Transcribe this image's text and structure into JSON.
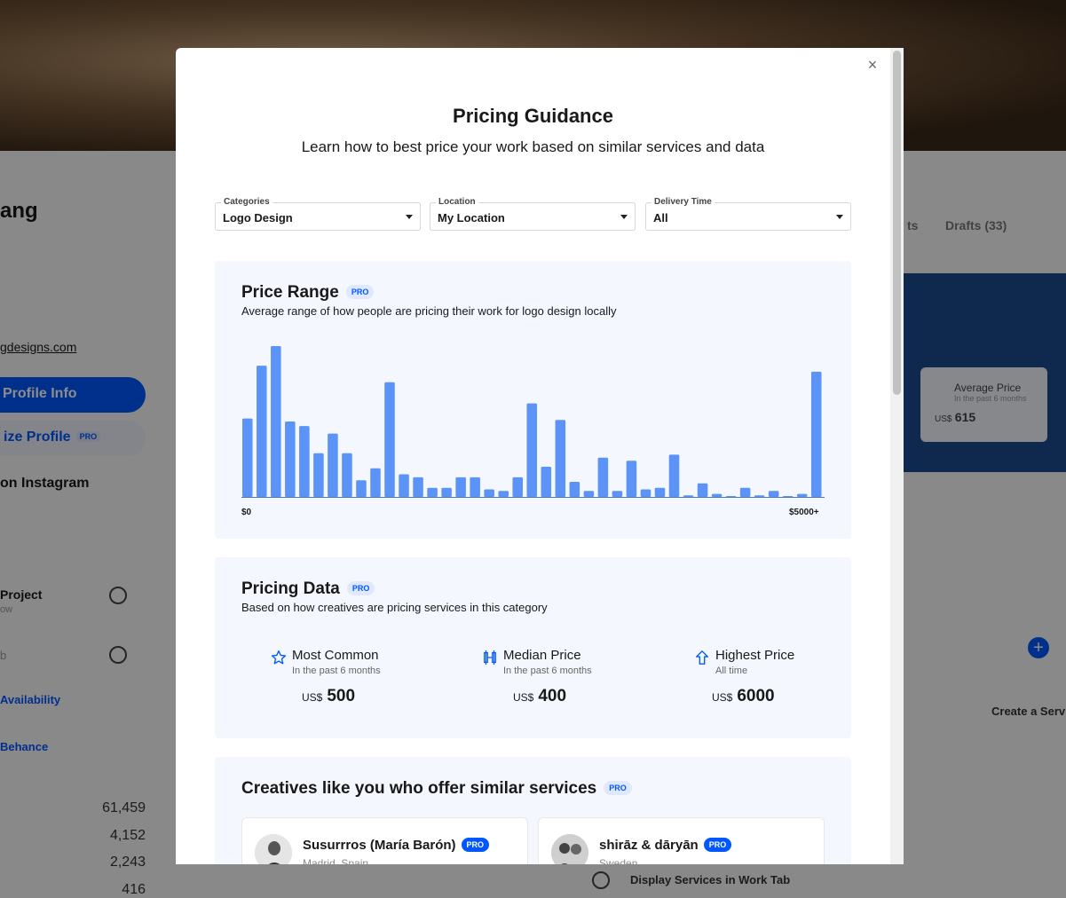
{
  "background": {
    "profile_name_fragment": "ang",
    "website_fragment": "gdesigns.com",
    "edit_profile_button": "Profile Info",
    "customize_profile_button": "ize Profile",
    "customize_pro": "PRO",
    "instagram_fragment": "on Instagram",
    "project_fragment": "Project",
    "project_sub_fragment": "ow",
    "job_fragment": "b",
    "availability_fragment": "Availability",
    "behance_fragment": "Behance",
    "stats": [
      "61,459",
      "4,152",
      "2,243",
      "416"
    ],
    "tab_fragment": "ts",
    "drafts_tab": "Drafts (33)",
    "avg_price_label": "Average Price",
    "avg_price_sub": "In the past 6 months",
    "avg_price_currency": "US$",
    "avg_price_value": "615",
    "create_service": "Create a Serv",
    "display_services": "Display Services in Work Tab"
  },
  "modal": {
    "title": "Pricing Guidance",
    "subtitle": "Learn how to best price your work based on similar services and data",
    "close_glyph": "×",
    "filters": [
      {
        "label": "Categories",
        "value": "Logo Design"
      },
      {
        "label": "Location",
        "value": "My Location"
      },
      {
        "label": "Delivery Time",
        "value": "All"
      }
    ],
    "price_range": {
      "title": "Price Range",
      "pro": "PRO",
      "description": "Average range of how people are pricing their work for logo design locally"
    },
    "pricing_data": {
      "title": "Pricing Data",
      "pro": "PRO",
      "description": "Based on how creatives are pricing services in this category",
      "stats": [
        {
          "name": "Most Common",
          "period": "In the past 6 months",
          "currency": "US$",
          "value": "500",
          "icon": "star-icon"
        },
        {
          "name": "Median Price",
          "period": "In the past 6 months",
          "currency": "US$",
          "value": "400",
          "icon": "median-icon"
        },
        {
          "name": "Highest Price",
          "period": "All time",
          "currency": "US$",
          "value": "6000",
          "icon": "arrow-up-icon"
        }
      ]
    },
    "creatives": {
      "title": "Creatives like you who offer similar services",
      "pro": "PRO",
      "cards": [
        {
          "name": "Susurrros (María Barón)",
          "badge": "PRO",
          "location": "Madrid, Spain"
        },
        {
          "name": "shirāz & dāryān",
          "badge": "PRO",
          "location": "Sweden"
        }
      ]
    }
  },
  "chart_data": {
    "type": "bar",
    "x_start_label": "$0",
    "x_end_label": "$5000+",
    "ylim": [
      0,
      100
    ],
    "values": [
      52,
      87,
      100,
      50,
      47,
      29,
      42,
      29,
      11,
      19,
      76,
      15,
      13,
      6,
      6,
      13,
      13,
      5,
      4,
      13,
      62,
      20,
      51,
      10,
      4,
      26,
      4,
      24,
      5,
      6,
      28,
      1,
      9,
      2,
      0.5,
      6,
      1,
      4,
      0.5,
      2,
      83
    ],
    "bar_color": "#5c93f7"
  }
}
